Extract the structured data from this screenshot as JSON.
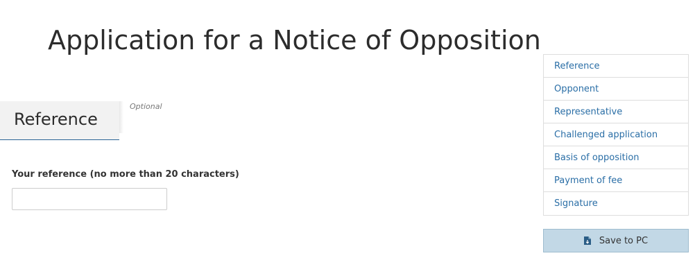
{
  "page": {
    "title": "Application for a Notice of Opposition"
  },
  "section": {
    "title": "Reference",
    "optional_label": "Optional"
  },
  "form": {
    "reference_label": "Your reference (no more than 20 characters)",
    "reference_value": "",
    "reference_placeholder": ""
  },
  "side_nav": {
    "items": [
      {
        "label": "Reference"
      },
      {
        "label": "Opponent"
      },
      {
        "label": "Representative"
      },
      {
        "label": "Challenged application"
      },
      {
        "label": "Basis of opposition"
      },
      {
        "label": "Payment of fee"
      },
      {
        "label": "Signature"
      }
    ]
  },
  "actions": {
    "save_label": "Save to PC",
    "save_icon": "file-download-icon"
  },
  "colors": {
    "link": "#2a6ea6",
    "accent_underline": "#2a6496",
    "save_button_bg": "#c2d8e6"
  }
}
